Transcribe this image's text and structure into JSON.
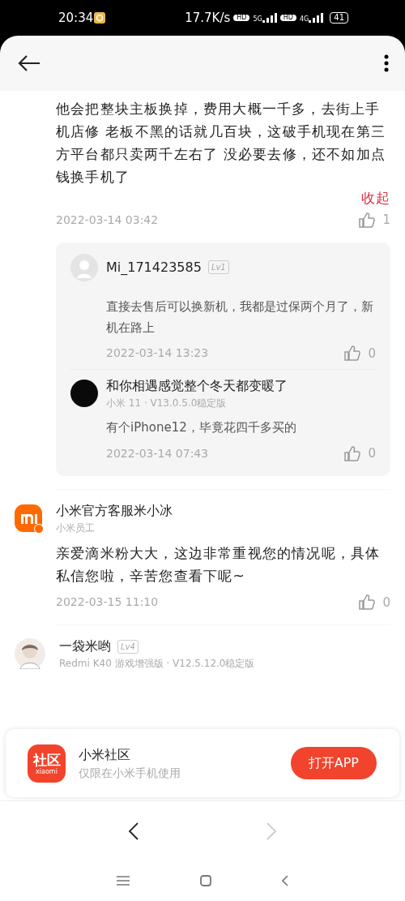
{
  "status_bar": {
    "time": "20:34",
    "speed": "17.7K/s",
    "sims": [
      {
        "hd": "HD",
        "network": "5G"
      },
      {
        "hd": "HD",
        "network": "4G"
      }
    ],
    "battery": "41"
  },
  "thread": {
    "text": "他会把整块主板换掉，费用大概一千多，去街上手机店修 老板不黑的话就几百块，这破手机现在第三方平台都只卖两千左右了 没必要去修，还不如加点钱换手机了",
    "collapse_link": "收起",
    "time": "2022-03-14 03:42",
    "likes": "1",
    "replies": [
      {
        "kind": "default",
        "user": "Mi_171423585",
        "level": "Lv1",
        "text": "直接去售后可以换新机，我都是过保两个月了，新机在路上",
        "time": "2022-03-14 13:23",
        "likes": "0"
      },
      {
        "kind": "dark",
        "user": "和你相遇感觉整个冬天都变暖了",
        "device": "小米 11 · V13.0.5.0稳定版",
        "text": "有个iPhone12，毕竟花四千多买的",
        "time": "2022-03-14 07:43",
        "likes": "0"
      }
    ]
  },
  "comments": [
    {
      "kind": "mi",
      "user": "小米官方客服米小冰",
      "subtitle": "小米员工",
      "text": "亲爱滴米粉大大，这边非常重视您的情况呢，具体私信您啦，辛苦您查看下呢~",
      "time": "2022-03-15 11:10",
      "likes": "0"
    },
    {
      "kind": "figure",
      "user": "一袋米哟",
      "level": "Lv4",
      "device": "Redmi K40 游戏增强版 · V12.5.12.0稳定版"
    }
  ],
  "app_banner": {
    "icon_text": "社区",
    "icon_brand": "xiaomi",
    "name": "小米社区",
    "tagline": "仅限在小米手机使用",
    "button": "打开APP"
  },
  "browser_nav": {
    "back": {
      "disabled": false
    },
    "forward": {
      "disabled": true
    }
  }
}
